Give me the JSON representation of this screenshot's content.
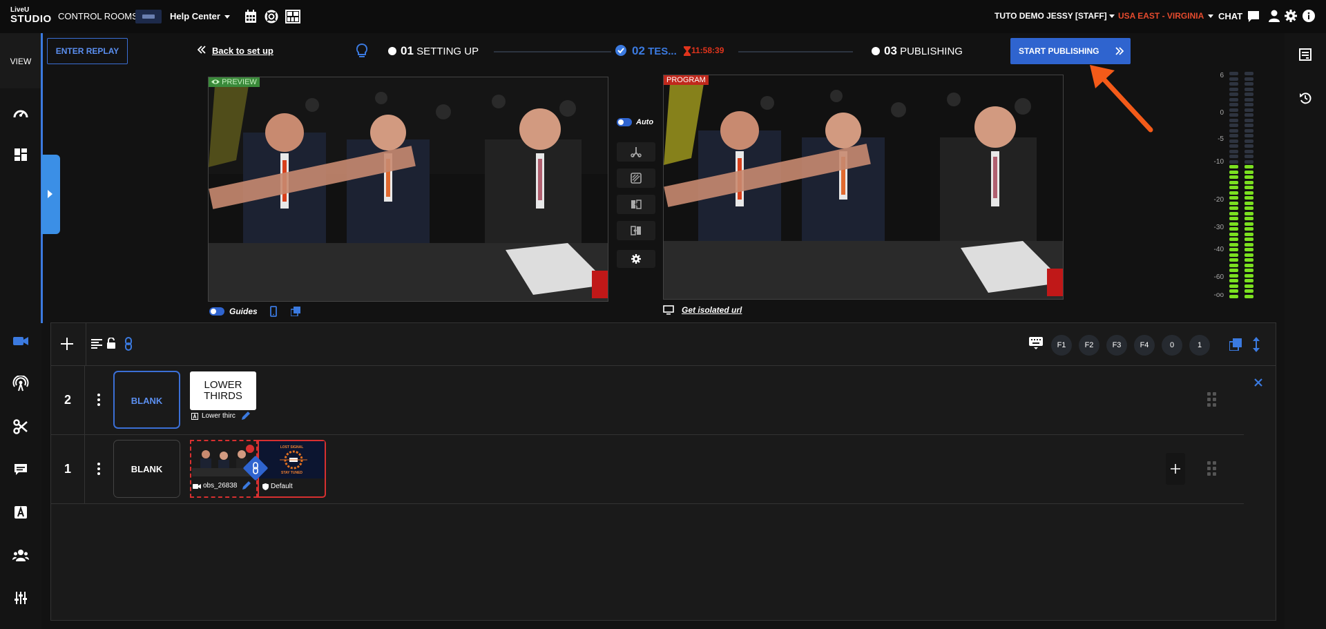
{
  "logo": {
    "line1": "LiveU",
    "line2": "STUDIO"
  },
  "topbar": {
    "control_rooms": "CONTROL ROOMS",
    "help_center": "Help Center",
    "user": "TUTO DEMO JESSY [STAFF]",
    "region": "USA EAST - VIRGINIA",
    "chat": "CHAT"
  },
  "sidebar": {
    "view_label": "VIEW"
  },
  "toolbar": {
    "enter_replay": "ENTER REPLAY",
    "back_to_setup": "Back to set up",
    "start_publishing": "START PUBLISHING"
  },
  "steps": [
    {
      "num": "01",
      "label": "SETTING UP"
    },
    {
      "num": "02",
      "label": "TES..."
    },
    {
      "num": "03",
      "label": "PUBLISHING"
    }
  ],
  "timer": "11:58:39",
  "preview": {
    "tag": "PREVIEW",
    "guides": "Guides"
  },
  "program": {
    "tag": "PROGRAM",
    "isolated_url": "Get isolated url"
  },
  "controls": {
    "auto": "Auto"
  },
  "vu_meter": {
    "labels": [
      "6",
      "0",
      "-5",
      "-10",
      "-20",
      "-30",
      "-40",
      "-60",
      "-oo"
    ],
    "level": 0.6
  },
  "layer_toolbar": {
    "fkeys": [
      "F1",
      "F2",
      "F3",
      "F4",
      "0",
      "1"
    ]
  },
  "layers": [
    {
      "number": "2",
      "blank": "BLANK",
      "card_title_1": "LOWER",
      "card_title_2": "THIRDS",
      "card_caption": "Lower thirc"
    },
    {
      "number": "1",
      "blank": "BLANK",
      "source_caption": "obs_26838",
      "graphic_caption": "Default",
      "graphic_text_top": "LOST SIGNAL",
      "graphic_text_bottom": "STAY TUNED"
    }
  ],
  "colors": {
    "accent": "#3b6fd6",
    "alert": "#e0341c",
    "meter_green": "#7be020",
    "arrow": "#f45b19"
  }
}
